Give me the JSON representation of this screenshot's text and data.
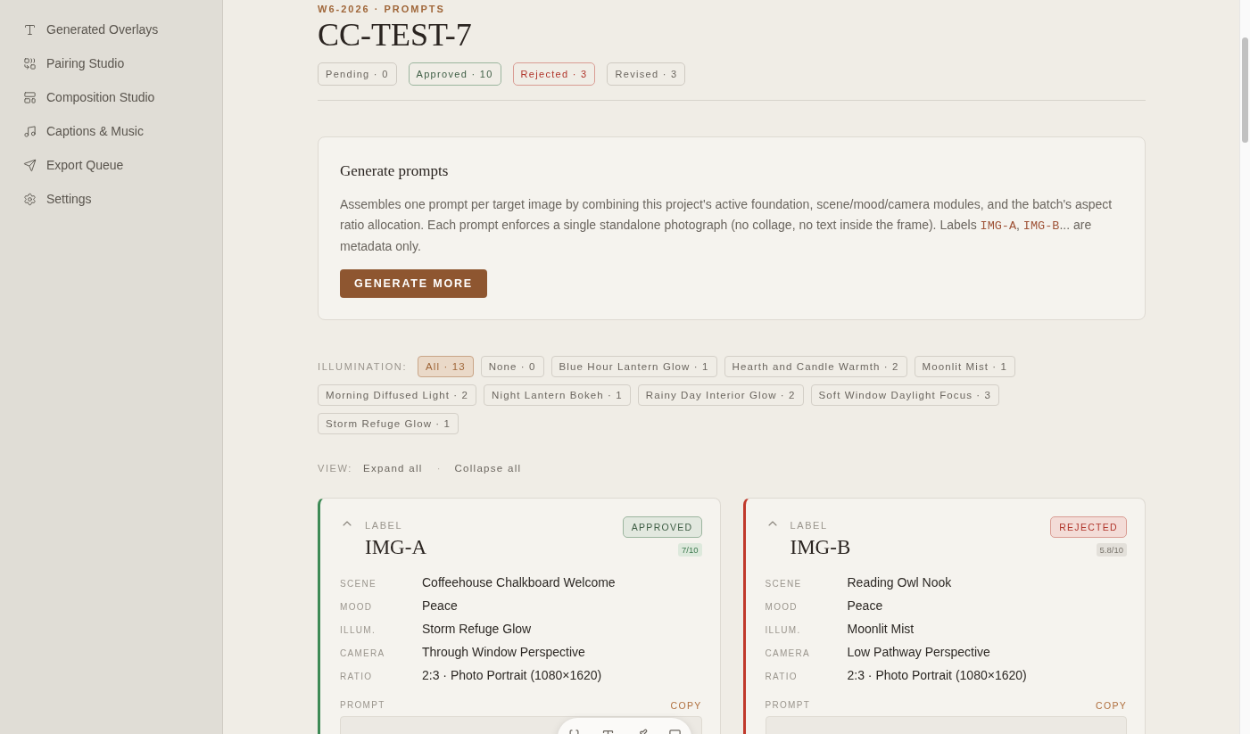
{
  "sidebar": {
    "items": [
      {
        "label": "Generated Overlays"
      },
      {
        "label": "Pairing Studio"
      },
      {
        "label": "Composition Studio"
      },
      {
        "label": "Captions & Music"
      },
      {
        "label": "Export Queue"
      },
      {
        "label": "Settings"
      }
    ]
  },
  "header": {
    "eyebrow": "W6-2026 · PROMPTS",
    "title": "CC-TEST-7",
    "status_counts": [
      {
        "label": "Pending · 0",
        "kind": "pending"
      },
      {
        "label": "Approved · 10",
        "kind": "approved"
      },
      {
        "label": "Rejected · 3",
        "kind": "rejected"
      },
      {
        "label": "Revised · 3",
        "kind": "revised"
      }
    ]
  },
  "generate": {
    "title": "Generate prompts",
    "description": [
      {
        "kind": "text",
        "text": "Assembles one prompt per target image by combining this project's active foundation, scene/mood/camera modules, and the batch's aspect ratio allocation. Each prompt enforces a single standalone photograph (no collage, no text inside the frame). Labels "
      },
      {
        "kind": "code",
        "text": "IMG-A"
      },
      {
        "kind": "text",
        "text": ", "
      },
      {
        "kind": "code",
        "text": "IMG-B"
      },
      {
        "kind": "text",
        "text": "... are metadata only."
      }
    ],
    "button": "GENERATE MORE"
  },
  "filters": {
    "label": "ILLUMINATION:",
    "chips": [
      {
        "label": "All · 13",
        "selected": true
      },
      {
        "label": "None · 0",
        "selected": false
      },
      {
        "label": "Blue Hour Lantern Glow · 1",
        "selected": false
      },
      {
        "label": "Hearth and Candle Warmth · 2",
        "selected": false
      },
      {
        "label": "Moonlit Mist · 1",
        "selected": false
      },
      {
        "label": "Morning Diffused Light · 2",
        "selected": false
      },
      {
        "label": "Night Lantern Bokeh · 1",
        "selected": false
      },
      {
        "label": "Rainy Day Interior Glow · 2",
        "selected": false
      },
      {
        "label": "Soft Window Daylight Focus · 3",
        "selected": false
      },
      {
        "label": "Storm Refuge Glow · 1",
        "selected": false
      }
    ]
  },
  "view": {
    "label": "VIEW:",
    "expand": "Expand all",
    "separator": "·",
    "collapse": "Collapse all"
  },
  "cards": [
    {
      "label_caption": "LABEL",
      "label": "IMG-A",
      "status": "APPROVED",
      "kind": "approved",
      "score": "7/10",
      "expanded": true,
      "fields": [
        {
          "name": "SCENE",
          "value": "Coffeehouse Chalkboard Welcome"
        },
        {
          "name": "MOOD",
          "value": "Peace"
        },
        {
          "name": "ILLUM.",
          "value": "Storm Refuge Glow"
        },
        {
          "name": "CAMERA",
          "value": "Through Window Perspective"
        },
        {
          "name": "RATIO",
          "value": "2:3 · Photo Portrait (1080×1620)"
        }
      ],
      "prompt_caption": "PROMPT",
      "copy": "COPY"
    },
    {
      "label_caption": "LABEL",
      "label": "IMG-B",
      "status": "REJECTED",
      "kind": "rejected",
      "score": "5.8/10",
      "expanded": true,
      "fields": [
        {
          "name": "SCENE",
          "value": "Reading Owl Nook"
        },
        {
          "name": "MOOD",
          "value": "Peace"
        },
        {
          "name": "ILLUM.",
          "value": "Moonlit Mist"
        },
        {
          "name": "CAMERA",
          "value": "Low Pathway Perspective"
        },
        {
          "name": "RATIO",
          "value": "2:3 · Photo Portrait (1080×1620)"
        }
      ],
      "prompt_caption": "PROMPT",
      "copy": "COPY"
    }
  ]
}
